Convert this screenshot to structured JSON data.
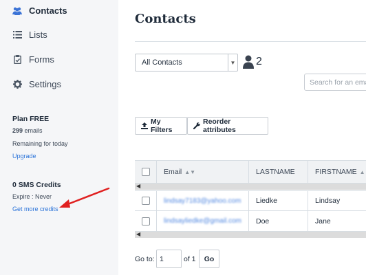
{
  "sidebar": {
    "items": [
      {
        "label": "Contacts",
        "icon": "users-icon",
        "active": true
      },
      {
        "label": "Lists",
        "icon": "list-icon"
      },
      {
        "label": "Forms",
        "icon": "clipboard-icon"
      },
      {
        "label": "Settings",
        "icon": "gear-icon"
      }
    ],
    "plan": {
      "title": "Plan FREE",
      "emails_count": "299",
      "emails_label": " emails",
      "remaining": "Remaining for today",
      "upgrade": "Upgrade"
    },
    "sms": {
      "title": "0 SMS Credits",
      "expire": "Expire : Never",
      "get_more": "Get more credits"
    },
    "annotation": {
      "icon": "red-arrow-icon",
      "color": "#e02020"
    }
  },
  "main": {
    "title": "Contacts",
    "list_select": {
      "value": "All Contacts"
    },
    "contact_count": "2",
    "search": {
      "placeholder": "Search for an email"
    },
    "buttons": {
      "filters": "My Filters",
      "reorder": "Reorder attributes"
    },
    "table": {
      "headers": {
        "email": "Email",
        "lastname": "LASTNAME",
        "firstname": "FIRSTNAME"
      },
      "rows": [
        {
          "email": "lindsay7183@yahoo.com",
          "lastname": "Liedke",
          "firstname": "Lindsay"
        },
        {
          "email": "lindsayliedke@gmail.com",
          "lastname": "Doe",
          "firstname": "Jane"
        }
      ]
    },
    "pagination": {
      "goto_label": "Go to:",
      "page": "1",
      "of_label": "of 1",
      "go_button": "Go"
    }
  },
  "colors": {
    "accent": "#3b73d6",
    "link": "#2c74d9",
    "sidebar_bg": "#f5f6f8",
    "arrow": "#e02020"
  }
}
